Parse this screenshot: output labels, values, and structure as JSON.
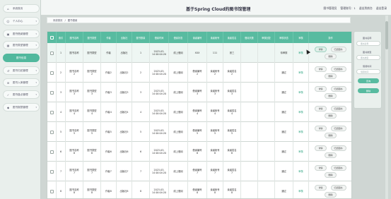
{
  "app": {
    "title": "基于Spring Cloud的图书馆管理"
  },
  "top_links": [
    "图书管理员",
    "管理账号：1",
    "退出到前台",
    "退出登录"
  ],
  "sidebar": {
    "items": [
      {
        "label": "系统首页",
        "icon": "home-icon",
        "active": false
      },
      {
        "label": "个人中心",
        "icon": "user-icon",
        "active": false
      },
      {
        "label": "图书借阅管理",
        "icon": "book-icon",
        "active": false
      },
      {
        "label": "图书类型管理",
        "icon": "grid-icon",
        "active": false
      },
      {
        "label": "图书信息",
        "icon": "",
        "active": true
      },
      {
        "label": "图书归还管理",
        "icon": "return-icon",
        "active": false
      },
      {
        "label": "图书入库管理",
        "icon": "stock-icon",
        "active": false
      },
      {
        "label": "图书盘点管理",
        "icon": "check-icon",
        "active": false
      },
      {
        "label": "图书报损管理",
        "icon": "broken-icon",
        "active": false
      }
    ]
  },
  "breadcrumb": {
    "home": "系统首页",
    "sep": "/",
    "current": "图书借阅"
  },
  "table": {
    "headers": [
      "",
      "索引",
      "图书名称",
      "图书类型",
      "作者",
      "出版社",
      "图书数量",
      "借阅时间",
      "借阅状态",
      "读者编号",
      "读者帐号",
      "读者姓名",
      "借阅天数",
      "审核回复",
      "审核状态",
      "审核",
      "操作"
    ],
    "rows": [
      {
        "index": "1",
        "name": "图书名称",
        "type": "图书类型",
        "author": "作者",
        "press": "出版社",
        "qty": "1",
        "time": "2023-03-\n14 00:04:20",
        "status": "线上借阅",
        "reader_no": "XXX",
        "account": "111",
        "reader_name": "张三",
        "days": "",
        "reply": "",
        "audit": "待审核",
        "review": "审核"
      },
      {
        "index": "2",
        "name": "图书名称\n2",
        "type": "图书类型\n2",
        "author": "作者2",
        "press": "出版社2",
        "qty": "2",
        "time": "2023-03-\n14 00:04:20",
        "status": "线上借阅",
        "reader_no": "借阅编号\n2",
        "account": "读者帐号\n2",
        "reader_name": "读者姓名\n2",
        "days": "",
        "reply": "",
        "audit": "通过",
        "review": "审核"
      },
      {
        "index": "3",
        "name": "图书名称\n3",
        "type": "图书类型\n3",
        "author": "作者3",
        "press": "出版社3",
        "qty": "3",
        "time": "2023-03-\n14 00:04:20",
        "status": "线上借阅",
        "reader_no": "借阅编号\n3",
        "account": "读者帐号\n3",
        "reader_name": "读者姓名\n3",
        "days": "",
        "reply": "",
        "audit": "通过",
        "review": "审核"
      },
      {
        "index": "4",
        "name": "图书名称\n4",
        "type": "图书类型\n4",
        "author": "作者4",
        "press": "出版社4",
        "qty": "4",
        "time": "2023-03-\n14 00:04:20",
        "status": "线上借阅",
        "reader_no": "借阅编号\n4",
        "account": "读者帐号\n4",
        "reader_name": "读者姓名\n4",
        "days": "",
        "reply": "",
        "audit": "通过",
        "review": "审核"
      },
      {
        "index": "5",
        "name": "图书名称\n5",
        "type": "图书类型\n5",
        "author": "作者5",
        "press": "出版社5",
        "qty": "5",
        "time": "2023-03-\n14 00:04:20",
        "status": "线上借阅",
        "reader_no": "借阅编号\n5",
        "account": "读者帐号\n5",
        "reader_name": "读者姓名\n5",
        "days": "",
        "reply": "",
        "audit": "通过",
        "review": "审核"
      },
      {
        "index": "6",
        "name": "图书名称\n6",
        "type": "图书类型\n6",
        "author": "作者6",
        "press": "出版社6",
        "qty": "6",
        "time": "2023-03-\n14 00:04:20",
        "status": "线上借阅",
        "reader_no": "借阅编号\n6",
        "account": "读者帐号\n6",
        "reader_name": "读者姓名\n6",
        "days": "",
        "reply": "",
        "audit": "通过",
        "review": "审核"
      },
      {
        "index": "7",
        "name": "图书名称\n7",
        "type": "图书类型\n7",
        "author": "作者7",
        "press": "出版社7",
        "qty": "7",
        "time": "2023-03-\n14 00:04:20",
        "status": "线上借阅",
        "reader_no": "借阅编号\n7",
        "account": "读者帐号\n7",
        "reader_name": "读者姓名\n7",
        "days": "",
        "reply": "",
        "audit": "通过",
        "review": "审核"
      },
      {
        "index": "8",
        "name": "图书名称\n8",
        "type": "图书类型\n8",
        "author": "作者8",
        "press": "出版社8",
        "qty": "8",
        "time": "2023-03-\n14 00:04:20",
        "status": "线上借阅",
        "reader_no": "借阅编号\n8",
        "account": "读者帐号\n8",
        "reader_name": "读者姓名\n8",
        "days": "",
        "reply": "",
        "audit": "通过",
        "review": "审核"
      }
    ],
    "ops": {
      "detail": "详情",
      "return": "归还图书",
      "delete": "删除"
    }
  },
  "search_panel": {
    "fields": [
      {
        "label": "图书名称",
        "placeholder": "图书名称"
      },
      {
        "label": "图书类型",
        "placeholder": "图书类型"
      },
      {
        "label": "借阅时间",
        "placeholder": "借阅时间"
      }
    ],
    "search_button": "查询",
    "delete_button": "删除"
  },
  "colors": {
    "accent": "#58bba0",
    "link": "#2fa582"
  }
}
